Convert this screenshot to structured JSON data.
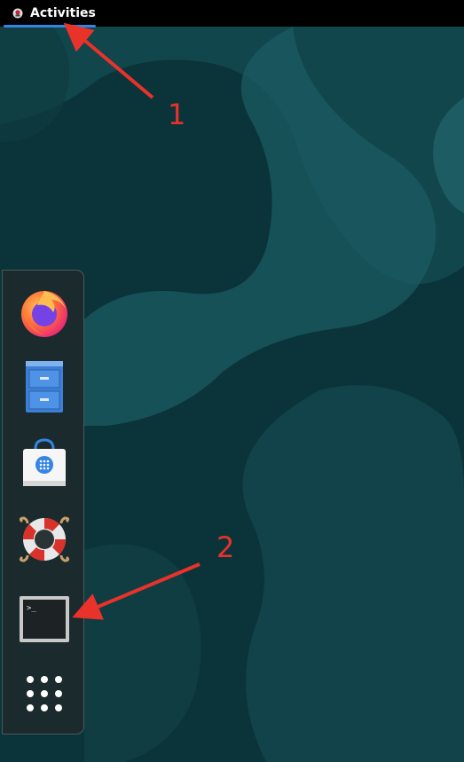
{
  "topbar": {
    "activities_label": "Activities"
  },
  "dock": {
    "items": [
      {
        "name": "Firefox",
        "icon": "firefox-icon"
      },
      {
        "name": "Files",
        "icon": "file-cabinet-icon"
      },
      {
        "name": "Software",
        "icon": "software-store-icon"
      },
      {
        "name": "Help",
        "icon": "lifebuoy-icon"
      },
      {
        "name": "Terminal",
        "icon": "terminal-icon"
      },
      {
        "name": "Show Applications",
        "icon": "app-grid-icon"
      }
    ]
  },
  "annotations": [
    {
      "label": "1"
    },
    {
      "label": "2"
    }
  ],
  "colors": {
    "accent": "#3584e4",
    "annotation": "#e8322a",
    "wallpaper": "#0d3a40"
  }
}
